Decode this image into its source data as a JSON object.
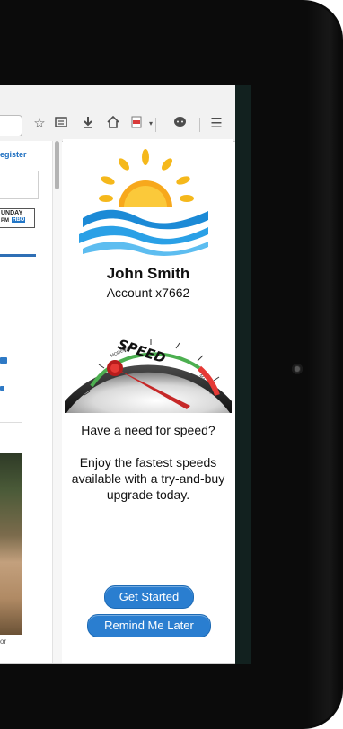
{
  "browser": {
    "toolbar_icons": [
      "star-icon",
      "reading-list-icon",
      "download-icon",
      "home-icon",
      "pdf-icon",
      "dropdown-arrow-icon",
      "chat-icon",
      "menu-icon"
    ]
  },
  "background_page": {
    "register_link": "egister",
    "sunday_badge_line1": "UNDAY",
    "sunday_badge_line2": "PM",
    "sunday_badge_brand": "HBO",
    "photo_caption": "or"
  },
  "ad": {
    "name": "John Smith",
    "account": "Account x7662",
    "headline": "Have a need for speed?",
    "body": "Enjoy the fastest speeds available with a try-and-buy upgrade today.",
    "gauge_word": "SPEED",
    "gauge_scale_labels": [
      "MODERATE",
      "MAXIMUM"
    ],
    "primary_button": "Get Started",
    "secondary_button": "Remind Me Later"
  },
  "colors": {
    "button_blue": "#2a7ed0",
    "sun_yellow": "#f5b81b",
    "wave_blue": "#1c8ad6"
  }
}
